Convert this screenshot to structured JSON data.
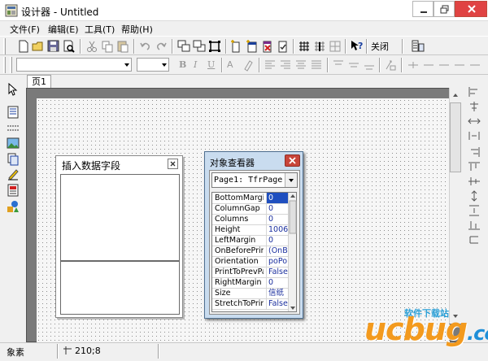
{
  "window": {
    "title": "设计器 - Untitled"
  },
  "menu": {
    "items": [
      "文件(F)",
      "编辑(E)",
      "工具(T)",
      "帮助(H)"
    ]
  },
  "toolbar": {
    "close_label": "关闭",
    "font_name": "",
    "font_size": ""
  },
  "design": {
    "tab_label": "页1"
  },
  "insert_field_panel": {
    "title": "插入数据字段"
  },
  "inspector": {
    "title": "对象查看器",
    "selected_object": "Page1: TfrPage",
    "properties": [
      {
        "name": "BottomMargin",
        "value": "0"
      },
      {
        "name": "ColumnGap",
        "value": "0"
      },
      {
        "name": "Columns",
        "value": "0"
      },
      {
        "name": "Height",
        "value": "1006"
      },
      {
        "name": "LeftMargin",
        "value": "0"
      },
      {
        "name": "OnBeforePrint",
        "value": "(OnBe"
      },
      {
        "name": "Orientation",
        "value": "poPo"
      },
      {
        "name": "PrintToPrevPa",
        "value": "False"
      },
      {
        "name": "RightMargin",
        "value": "0"
      },
      {
        "name": "Size",
        "value": "信纸"
      },
      {
        "name": "StretchToPrint",
        "value": "False"
      }
    ]
  },
  "status": {
    "left_text": "象素",
    "position": "210;8"
  },
  "watermark": {
    "brand": "ucbug",
    "suffix": ".cc",
    "tagline": "软件下载站"
  },
  "colors": {
    "accent": "#1f7fd1",
    "watermark_orange": "#f39a1e",
    "watermark_blue": "#1f8fd8",
    "design_bg": "#7a7a7a"
  }
}
